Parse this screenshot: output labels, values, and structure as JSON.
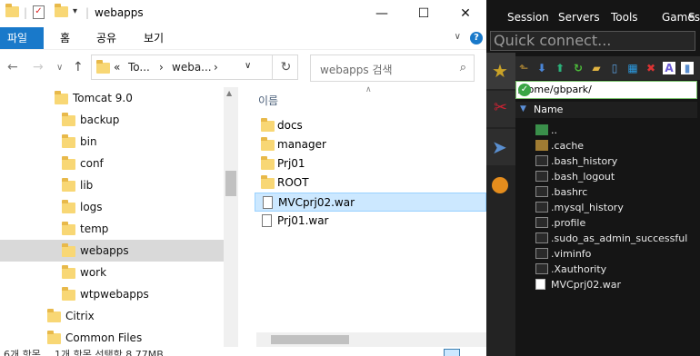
{
  "explorer": {
    "window_title": "webapps",
    "ribbon_tabs": [
      "파일",
      "홈",
      "공유",
      "보기"
    ],
    "address": {
      "prefix": "«",
      "segments": [
        "To...",
        "weba..."
      ],
      "sep": "›"
    },
    "search_placeholder": "webapps 검색",
    "column_header": "이름",
    "nav_tree": [
      {
        "label": "Tomcat 9.0",
        "indent": 0
      },
      {
        "label": "backup",
        "indent": 1
      },
      {
        "label": "bin",
        "indent": 1
      },
      {
        "label": "conf",
        "indent": 1
      },
      {
        "label": "lib",
        "indent": 1
      },
      {
        "label": "logs",
        "indent": 1
      },
      {
        "label": "temp",
        "indent": 1
      },
      {
        "label": "webapps",
        "indent": 1,
        "selected": true
      },
      {
        "label": "work",
        "indent": 1
      },
      {
        "label": "wtpwebapps",
        "indent": 1
      },
      {
        "label": "Citrix",
        "indent": -1
      },
      {
        "label": "Common Files",
        "indent": -1
      }
    ],
    "files": [
      {
        "name": "docs",
        "type": "folder"
      },
      {
        "name": "manager",
        "type": "folder"
      },
      {
        "name": "Prj01",
        "type": "folder"
      },
      {
        "name": "ROOT",
        "type": "folder"
      },
      {
        "name": "MVCprj02.war",
        "type": "file",
        "selected": true
      },
      {
        "name": "Prj01.war",
        "type": "file"
      }
    ],
    "status_left": "6개 항목",
    "status_mid": "1개 항목 선택함 8.77MB"
  },
  "moba": {
    "toolbar": [
      "Session",
      "Servers",
      "Tools",
      "Games"
    ],
    "quick_connect": "Quick connect...",
    "path": "/home/gbpark/",
    "column_header": "Name",
    "entries": [
      {
        "name": "..",
        "icon": "up"
      },
      {
        "name": ".cache",
        "icon": "fold"
      },
      {
        "name": ".bash_history",
        "icon": "doc"
      },
      {
        "name": ".bash_logout",
        "icon": "doc"
      },
      {
        "name": ".bashrc",
        "icon": "doc"
      },
      {
        "name": ".mysql_history",
        "icon": "doc"
      },
      {
        "name": ".profile",
        "icon": "doc"
      },
      {
        "name": ".sudo_as_admin_successful",
        "icon": "doc"
      },
      {
        "name": ".viminfo",
        "icon": "doc"
      },
      {
        "name": ".Xauthority",
        "icon": "doc"
      },
      {
        "name": "MVCprj02.war",
        "icon": "war"
      }
    ]
  },
  "colors": {
    "accent": "#1979ca",
    "selection": "#cce8ff",
    "tree_selection": "#d9d9d9",
    "folder": "#f8d775",
    "moba_bg": "#151515"
  }
}
